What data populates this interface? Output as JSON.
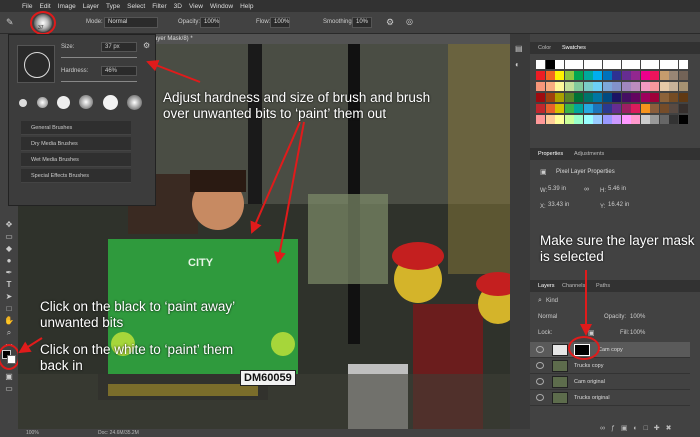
{
  "menu": [
    "File",
    "Edit",
    "Image",
    "Layer",
    "Type",
    "Select",
    "Filter",
    "3D",
    "View",
    "Window",
    "Help"
  ],
  "options": {
    "brush_size_badge": "37",
    "mode_label": "Mode:",
    "mode_value": "Normal",
    "opacity_label": "Opacity:",
    "opacity_value": "100%",
    "flow_label": "Flow:",
    "flow_value": "100%",
    "smoothing_label": "Smoothing:",
    "smoothing_value": "10%"
  },
  "document_tab": "ayer Mask/8) *",
  "brush_panel": {
    "size_label": "Size:",
    "size_value": "37 px",
    "hardness_label": "Hardness:",
    "hardness_value": "46%",
    "folders": [
      "General Brushes",
      "Dry Media Brushes",
      "Wet Media Brushes",
      "Special Effects Brushes"
    ]
  },
  "swatches_panel": {
    "tabs": [
      "Color",
      "Swatches"
    ]
  },
  "properties_panel": {
    "tabs": [
      "Properties",
      "Adjustments"
    ],
    "title": "Pixel Layer Properties",
    "w_label": "W:",
    "w_value": "5.39 in",
    "h_label": "H:",
    "h_value": "5.46 in",
    "x_label": "X:",
    "x_value": "33.43 in",
    "y_label": "Y:",
    "y_value": "16.42 in"
  },
  "layers_panel": {
    "tabs": [
      "Layers",
      "Channels",
      "Paths"
    ],
    "kind_label": "Kind",
    "blend_value": "Normal",
    "opacity_label": "Opacity:",
    "opacity_value": "100%",
    "lock_label": "Lock:",
    "fill_label": "Fill:",
    "fill_value": "100%",
    "layers": [
      "Cam copy",
      "Trucks copy",
      "Cam original",
      "Trucks original"
    ]
  },
  "status": {
    "zoom": "100%",
    "doc": "Doc: 24.6M/35.2M"
  },
  "canvas": {
    "license_plate": "DM60059",
    "truck_logo": "CITY"
  },
  "annotations": {
    "adjust": "Adjust hardness and size of brush and brush over unwanted bits to ‘paint’ them out",
    "mask": "Make sure the layer mask is selected",
    "black": "Click on the black to ‘paint away’ unwanted bits",
    "white": "Click on the white to ‘paint’ them back in"
  },
  "colors": {
    "annotation_arrow": "#e01b1b",
    "accent": "#31a8ff"
  }
}
